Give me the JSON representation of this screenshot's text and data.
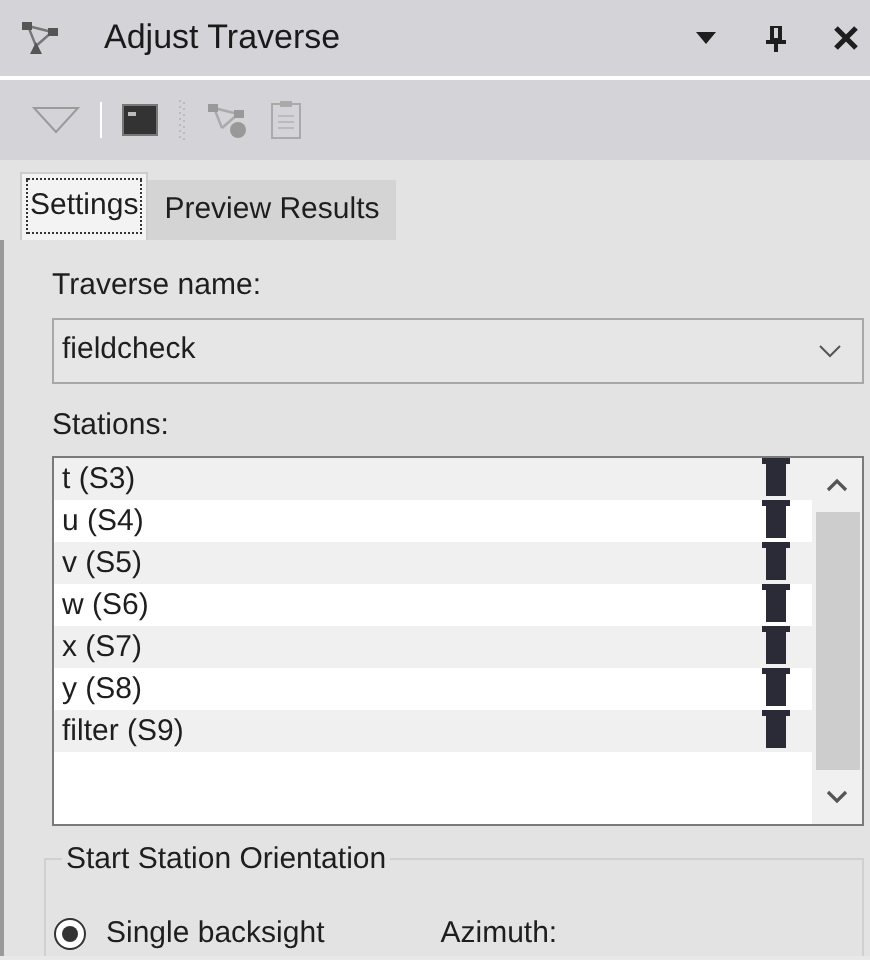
{
  "window": {
    "title": "Adjust Traverse"
  },
  "tabs": [
    {
      "label": "Settings",
      "selected": true
    },
    {
      "label": "Preview Results",
      "selected": false
    }
  ],
  "traverse_name": {
    "label": "Traverse name:",
    "value": "fieldcheck"
  },
  "stations": {
    "label": "Stations:",
    "items": [
      {
        "name": "t (S3)"
      },
      {
        "name": "u (S4)"
      },
      {
        "name": "v (S5)"
      },
      {
        "name": "w (S6)"
      },
      {
        "name": "x (S7)"
      },
      {
        "name": "y (S8)"
      },
      {
        "name": "filter (S9)"
      }
    ]
  },
  "orientation": {
    "title": "Start Station Orientation",
    "options": [
      {
        "label": "Single backsight",
        "selected": true
      }
    ],
    "azimuth_label": "Azimuth:"
  }
}
